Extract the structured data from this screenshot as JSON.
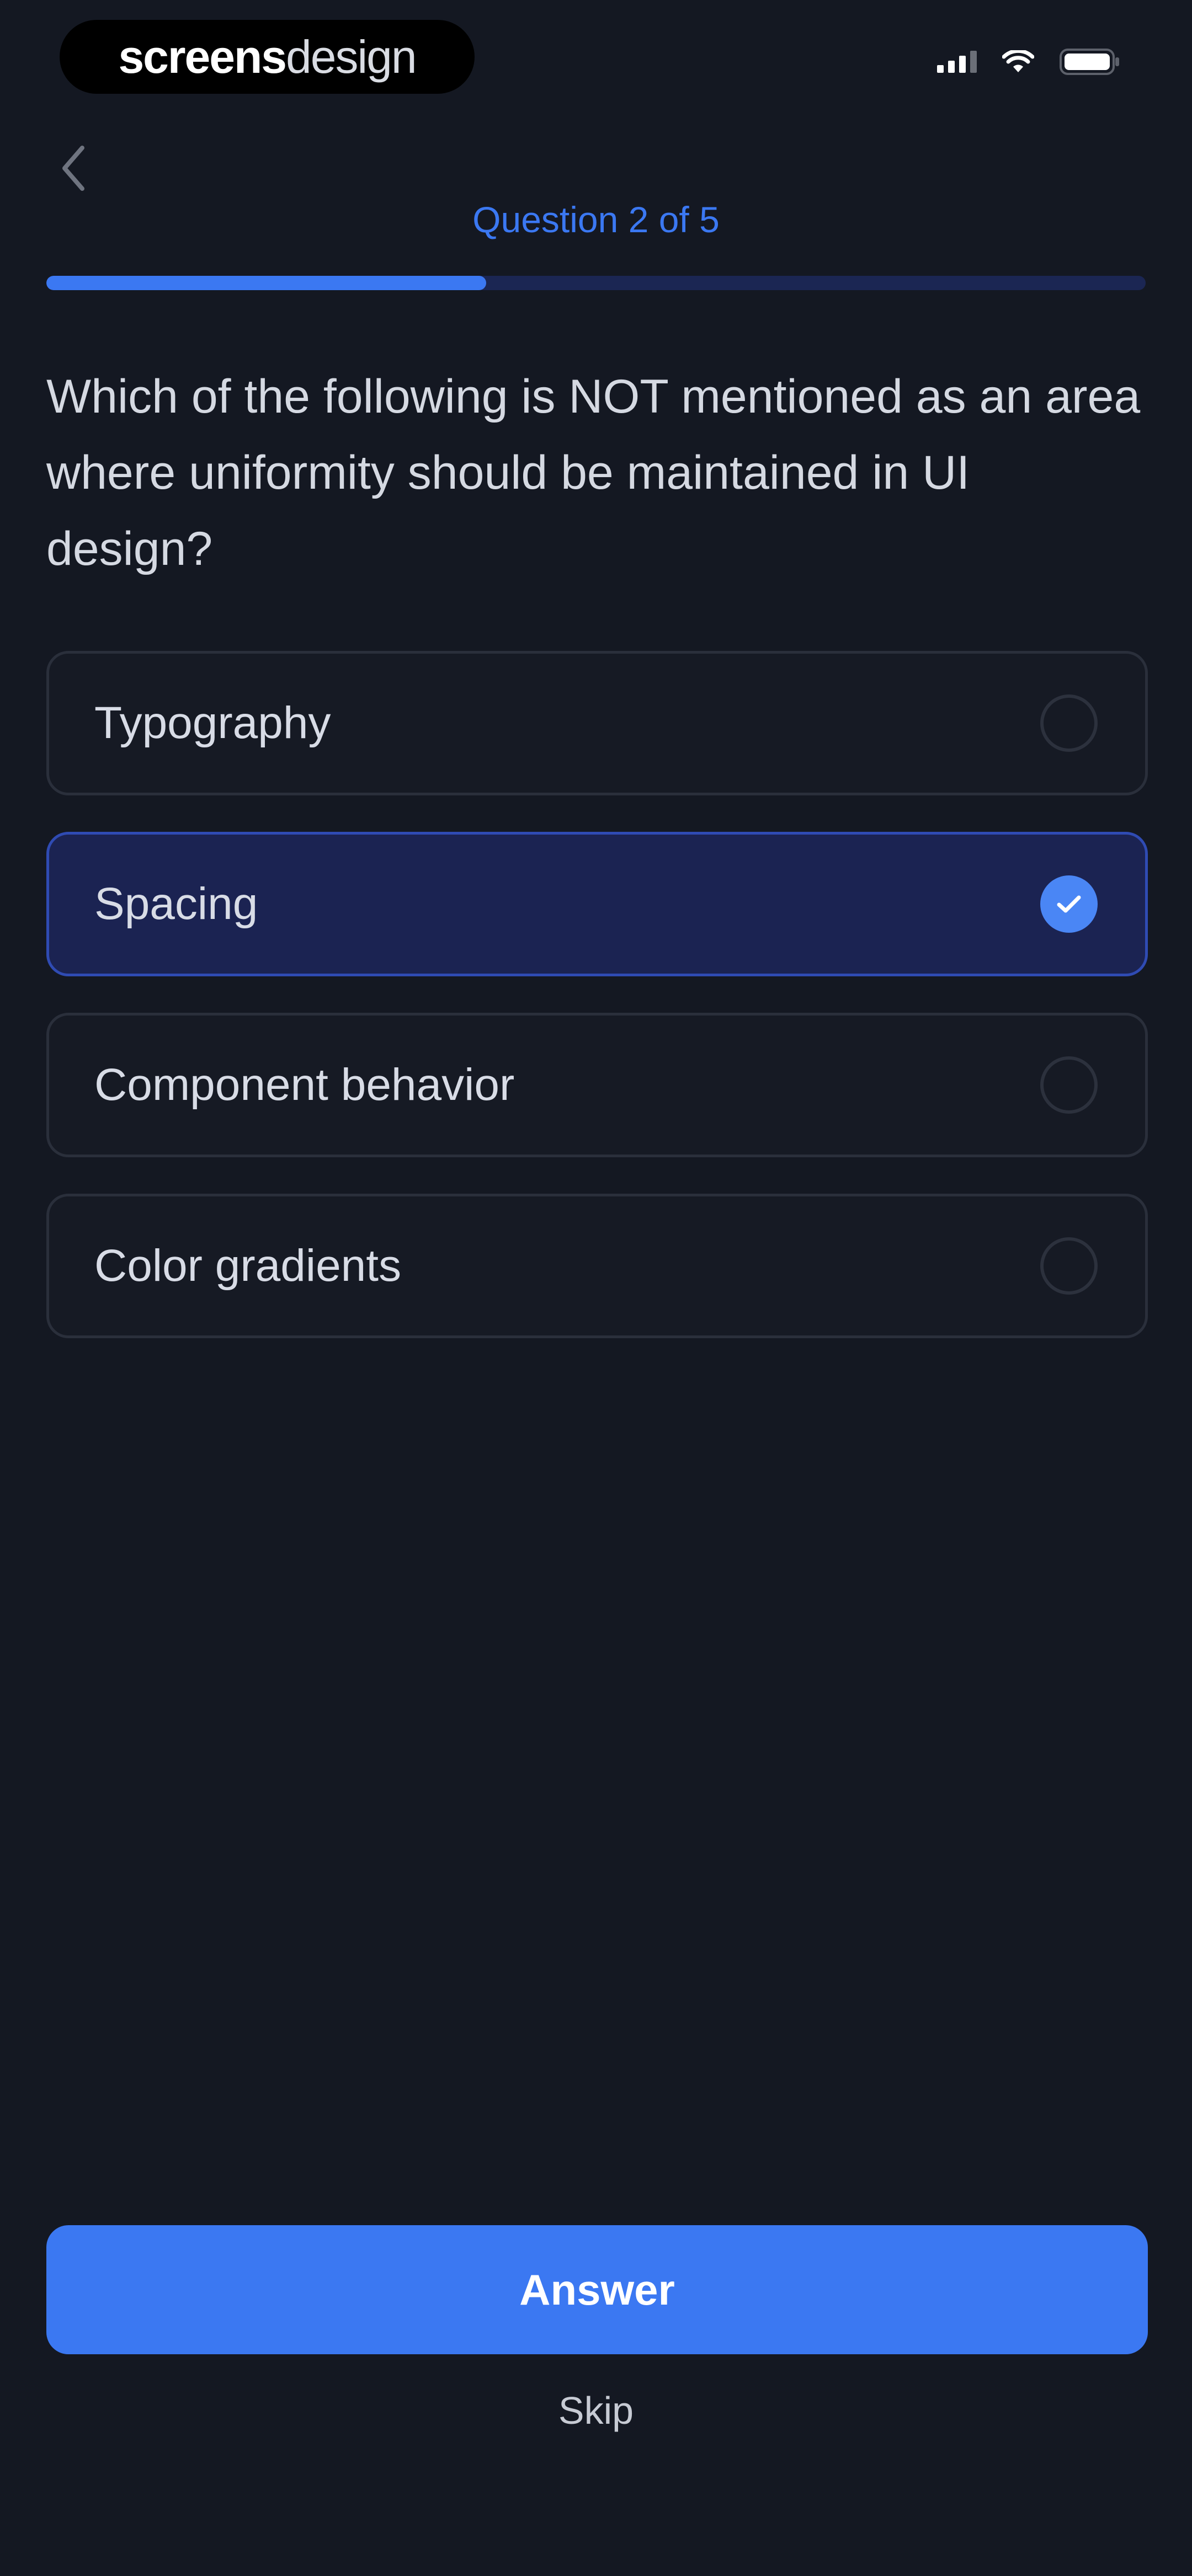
{
  "status_bar": {
    "brand_bold": "screens",
    "brand_light": "design",
    "icons": [
      "cellular-signal-icon",
      "wifi-icon",
      "battery-icon"
    ]
  },
  "header": {
    "back_icon": "chevron-left-icon",
    "question_counter": "Question 2 of 5",
    "progress_fraction": 0.4
  },
  "question": {
    "text": "Which of the following is NOT mentioned as an area where uniformity should be maintained in UI design?"
  },
  "options": [
    {
      "label": "Typography",
      "selected": false
    },
    {
      "label": "Spacing",
      "selected": true
    },
    {
      "label": "Component behavior",
      "selected": false
    },
    {
      "label": "Color gradients",
      "selected": false
    }
  ],
  "actions": {
    "answer_label": "Answer",
    "skip_label": "Skip"
  },
  "colors": {
    "background": "#141822",
    "accent": "#3b78f2",
    "selected_option_bg": "#1b2352",
    "progress_track": "#1b2653"
  }
}
